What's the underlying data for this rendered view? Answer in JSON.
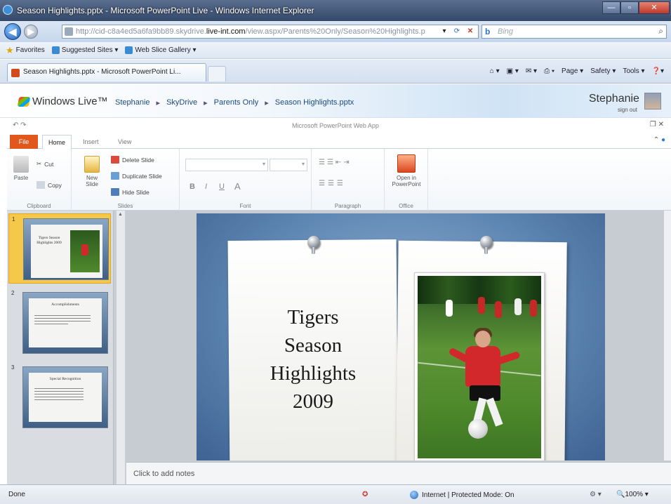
{
  "browser": {
    "window_title": "Season Highlights.pptx - Microsoft PowerPoint Live - Windows Internet Explorer",
    "url_prefix": "http://cid-c8a4ed5a6fa9bb89.skydrive.",
    "url_domain": "live-int.com",
    "url_suffix": "/view.aspx/Parents%20Only/Season%20Highlights.p",
    "search_placeholder": "Bing",
    "favorites": [
      "Favorites",
      "Suggested Sites ▾",
      "Web Slice Gallery ▾"
    ],
    "tab_title": "Season Highlights.pptx - Microsoft PowerPoint Li...",
    "commands": [
      "Page ▾",
      "Safety ▾",
      "Tools ▾"
    ]
  },
  "live_header": {
    "logo": "Windows Live™",
    "breadcrumb": [
      "Stephanie",
      "SkyDrive",
      "Parents Only",
      "Season Highlights.pptx"
    ],
    "user_name": "Stephanie",
    "sign_out": "sign out"
  },
  "app": {
    "title": "Microsoft PowerPoint Web App",
    "ribbon_tabs": [
      "File",
      "Home",
      "Insert",
      "View"
    ],
    "clipboard": {
      "paste": "Paste",
      "cut": "Cut",
      "copy": "Copy",
      "label": "Clipboard"
    },
    "slides": {
      "new_slide": "New Slide",
      "delete": "Delete Slide",
      "duplicate": "Duplicate Slide",
      "hide": "Hide Slide",
      "label": "Slides"
    },
    "font": {
      "bold": "B",
      "italic": "I",
      "underline": "U",
      "color": "A",
      "label": "Font"
    },
    "paragraph": {
      "label": "Paragraph"
    },
    "office": {
      "open": "Open in PowerPoint",
      "label": "Office"
    }
  },
  "thumbnails": [
    {
      "num": "1",
      "title": "Tigers Season Highlights 2009",
      "selected": true
    },
    {
      "num": "2",
      "title": "Accomplishments",
      "selected": false
    },
    {
      "num": "3",
      "title": "Special Recognition",
      "selected": false
    }
  ],
  "slide": {
    "title_lines": [
      "Tigers",
      "Season",
      "Highlights",
      "2009"
    ]
  },
  "notes_placeholder": "Click to add notes",
  "status": {
    "left": "Done",
    "zone": "Internet | Protected Mode: On",
    "zoom": "100%"
  }
}
